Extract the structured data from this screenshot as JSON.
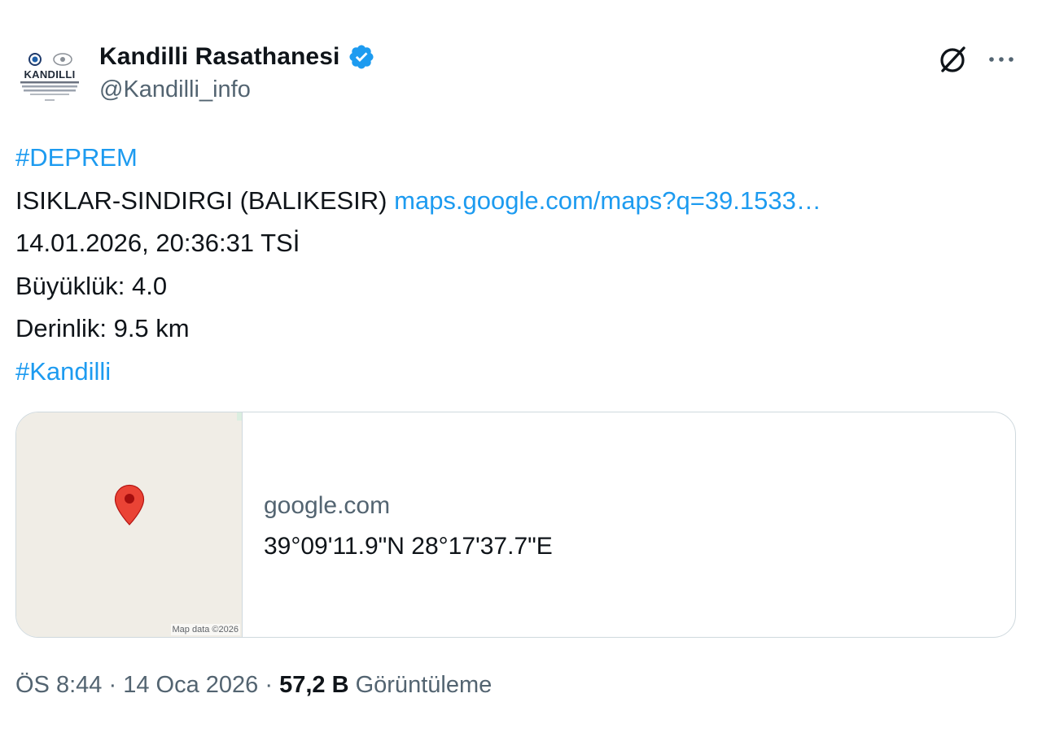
{
  "author": {
    "name": "Kandilli Rasathanesi",
    "handle": "@Kandilli_info",
    "verified_color": "#1d9bf0",
    "avatar_text": "KANDILLI"
  },
  "icons": {
    "grok": "grok-slash-circle-icon",
    "more": "more-dots-icon",
    "verified": "verified-badge-icon",
    "map_pin": "map-pin-icon"
  },
  "tweet": {
    "hashtag_deprem": "#DEPREM",
    "location": "ISIKLAR-SINDIRGI (BALIKESIR)",
    "map_link": "maps.google.com/maps?q=39.1533…",
    "datetime": "14.01.2026, 20:36:31 TSİ",
    "magnitude": "Büyüklük: 4.0",
    "depth": "Derinlik: 9.5 km",
    "hashtag_kandilli": "#Kandilli"
  },
  "card": {
    "domain": "google.com",
    "title": "39°09'11.9\"N 28°17'37.7\"E",
    "map_attribution": "Map data ©2026"
  },
  "footer": {
    "time": "ÖS 8:44",
    "separator": "·",
    "date": "14 Oca 2026",
    "views_count": "57,2 B",
    "views_label": "Görüntüleme"
  },
  "colors": {
    "link": "#1d9bf0",
    "text": "#0f1419",
    "secondary": "#536471",
    "border": "#cfd9de",
    "map_bg": "#f0ede6",
    "pin": "#ea4335"
  }
}
